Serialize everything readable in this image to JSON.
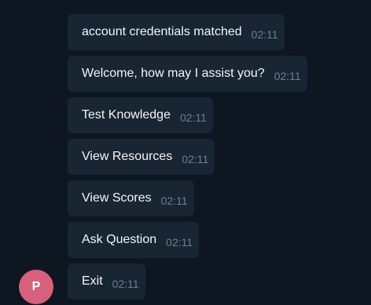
{
  "messages": [
    {
      "text": "account credentials matched",
      "time": "02:11"
    },
    {
      "text": "Welcome, how may I assist you?",
      "time": "02:11"
    },
    {
      "text": "Test Knowledge",
      "time": "02:11"
    },
    {
      "text": "View Resources",
      "time": "02:11"
    },
    {
      "text": "View Scores",
      "time": "02:11"
    },
    {
      "text": "Ask Question",
      "time": "02:11"
    },
    {
      "text": "Exit",
      "time": "02:11"
    }
  ],
  "avatar": {
    "initial": "P",
    "color": "#d7617c"
  }
}
